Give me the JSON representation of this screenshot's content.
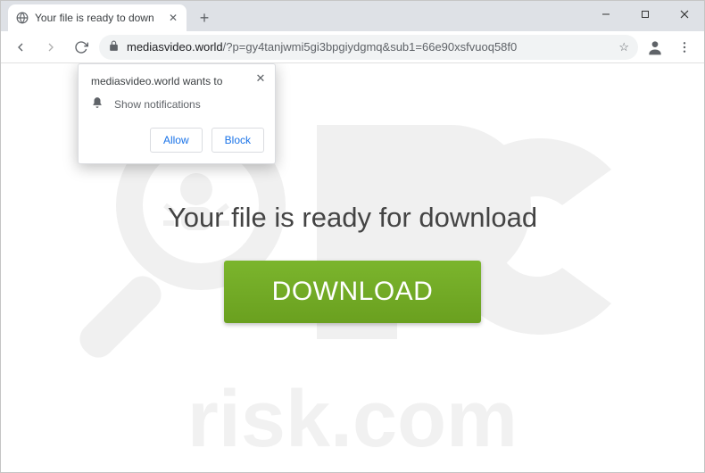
{
  "tab": {
    "title": "Your file is ready to down",
    "close_glyph": "✕"
  },
  "titlebar": {
    "newtab_glyph": "+"
  },
  "window_controls": {
    "minimize": "—",
    "maximize": "☐",
    "close": "✕"
  },
  "toolbar": {
    "url_host": "mediasvideo.world",
    "url_path": "/?p=gy4tanjwmi5gi3bpgiydgmq&sub1=66e90xsfvuoq58f0",
    "star_glyph": "☆"
  },
  "prompt": {
    "origin_text": "mediasvideo.world wants to",
    "permission_label": "Show notifications",
    "allow_label": "Allow",
    "block_label": "Block",
    "close_glyph": "✕"
  },
  "page": {
    "headline": "Your file is ready for download",
    "download_label": "DOWNLOAD"
  },
  "watermark": {
    "text": "risk.com"
  }
}
